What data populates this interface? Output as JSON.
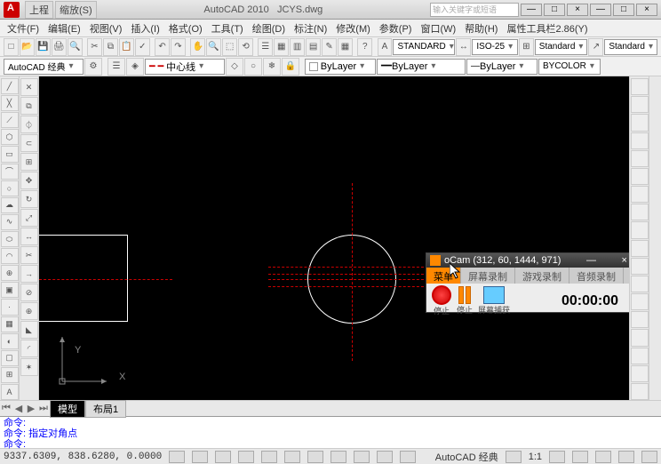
{
  "title": {
    "app": "AutoCAD 2010",
    "file": "JCYS.dwg"
  },
  "titletabs": [
    "上程",
    "缩放(S)"
  ],
  "search_placeholder": "输入关键字或短语",
  "winbtns": {
    "min": "—",
    "max": "□",
    "close": "×",
    "min2": "—",
    "max2": "□",
    "close2": "×"
  },
  "menus": [
    "文件(F)",
    "编辑(E)",
    "视图(V)",
    "插入(I)",
    "格式(O)",
    "工具(T)",
    "绘图(D)",
    "标注(N)",
    "修改(M)",
    "参数(P)",
    "窗口(W)",
    "帮助(H)",
    "属性工具栏2.86(Y)"
  ],
  "toolbar1": {
    "combos": {
      "textstyle": "STANDARD",
      "dimstyle": "ISO-25",
      "tablestyle": "Standard",
      "mlstyle": "Standard"
    }
  },
  "toolbar2": {
    "workspace": "AutoCAD 经典",
    "linetype": "中心线",
    "layer": "ByLayer",
    "color": "ByLayer",
    "lw": "ByLayer",
    "ps": "BYCOLOR"
  },
  "axis": {
    "x": "X",
    "y": "Y"
  },
  "ocam": {
    "title": "oCam (312, 60, 1444, 971)",
    "tabs": [
      "菜单",
      "屏幕录制",
      "游戏录制",
      "音频录制"
    ],
    "stop": "停止",
    "pause": "停止",
    "capture": "屏幕捕获",
    "time": "00:00:00"
  },
  "modeltabs": {
    "model": "模型",
    "layout": "布局1"
  },
  "cmd": {
    "l1": "命令:",
    "l2": "命令: 指定对角点",
    "l3": "命令:"
  },
  "status": {
    "coords": "9337.6309, 838.6280, 0.0000",
    "right": "AutoCAD 经典",
    "scale": "1:1"
  }
}
